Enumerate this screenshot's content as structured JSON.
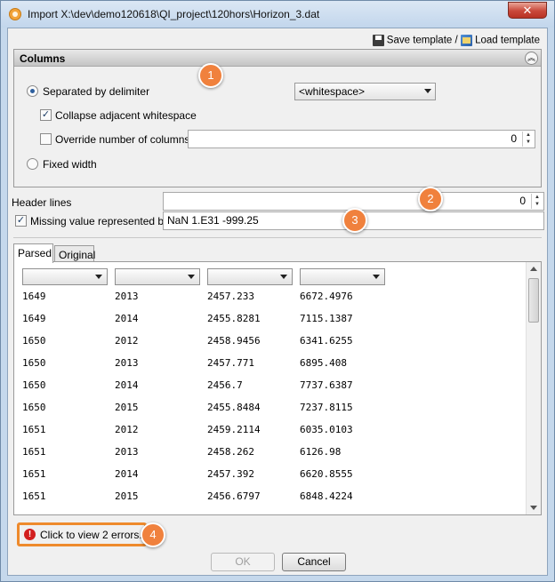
{
  "window": {
    "title": "Import X:\\dev\\demo120618\\QI_project\\120hors\\Horizon_3.dat",
    "close_label": "✕"
  },
  "toolbar": {
    "save_template": "Save template",
    "separator": "/",
    "load_template": "Load template"
  },
  "columns_section": {
    "title": "Columns",
    "separated_label": "Separated by delimiter",
    "delimiter_value": "<whitespace>",
    "collapse_label": "Collapse adjacent whitespace",
    "override_label": "Override number of columns",
    "override_value": "0",
    "fixed_width_label": "Fixed width"
  },
  "header_lines": {
    "label": "Header lines",
    "value": "0"
  },
  "missing_value": {
    "label": "Missing value represented by",
    "value": "NaN 1.E31 -999.25"
  },
  "tabs": {
    "parsed": "Parsed",
    "original": "Original"
  },
  "table": {
    "rows": [
      [
        "1649",
        "2013",
        "2457.233",
        "6672.4976"
      ],
      [
        "1649",
        "2014",
        "2455.8281",
        "7115.1387"
      ],
      [
        "1650",
        "2012",
        "2458.9456",
        "6341.6255"
      ],
      [
        "1650",
        "2013",
        "2457.771",
        "6895.408"
      ],
      [
        "1650",
        "2014",
        "2456.7",
        "7737.6387"
      ],
      [
        "1650",
        "2015",
        "2455.8484",
        "7237.8115"
      ],
      [
        "1651",
        "2012",
        "2459.2114",
        "6035.0103"
      ],
      [
        "1651",
        "2013",
        "2458.262",
        "6126.98"
      ],
      [
        "1651",
        "2014",
        "2457.392",
        "6620.8555"
      ],
      [
        "1651",
        "2015",
        "2456.6797",
        "6848.4224"
      ]
    ]
  },
  "status": {
    "errors_text": "Click to view 2 errors."
  },
  "buttons": {
    "ok": "OK",
    "cancel": "Cancel"
  },
  "callouts": {
    "c1": "1",
    "c2": "2",
    "c3": "3",
    "c4": "4"
  },
  "colors": {
    "callout": "#f0813d",
    "error_highlight": "#ee8a2c",
    "error_icon": "#d21f1f"
  }
}
